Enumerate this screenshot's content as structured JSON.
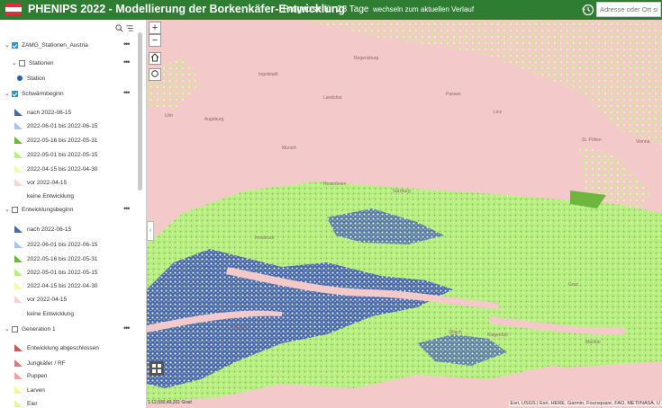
{
  "header": {
    "title": "PHENIPS 2022 - Modellierung der Borkenkäfer-Entwicklung",
    "forecast": "Prognose für 28 Tage",
    "switch_link": "wechseln zum aktuellen Verlauf",
    "search_placeholder": "Adresse oder Ort suchen",
    "flag_colors": [
      "#ed2939",
      "#ffffff",
      "#ed2939"
    ]
  },
  "layers": [
    {
      "kind": "layer",
      "label": "ZAMG_Stationen_Austria",
      "checked": true
    },
    {
      "kind": "sublayer",
      "label": "Stationen",
      "checked": false
    },
    {
      "kind": "legend",
      "label": "Station",
      "color": "#2a5db0",
      "shape": "dot"
    },
    {
      "kind": "layer",
      "label": "Schwärmbeginn",
      "checked": true
    },
    {
      "kind": "legend",
      "label": "nach 2022-06-15",
      "color": "#4a69a7"
    },
    {
      "kind": "legend",
      "label": "2022-06-01 bis 2022-06-15",
      "color": "#a9c6f0"
    },
    {
      "kind": "legend",
      "label": "2022-05-16 bis 2022-05-31",
      "color": "#6fb63f"
    },
    {
      "kind": "legend",
      "label": "2022-05-01 bis 2022-05-15",
      "color": "#b9f07a"
    },
    {
      "kind": "legend",
      "label": "2022-04-15 bis 2022-04-30",
      "color": "#f0fbb0"
    },
    {
      "kind": "legend",
      "label": "vor 2022-04-15",
      "color": "#f8d3d3"
    },
    {
      "kind": "legend",
      "label": "keine Entwicklung",
      "color": "#ffffff"
    },
    {
      "kind": "layer",
      "label": "Entwicklungsbeginn",
      "checked": false
    },
    {
      "kind": "legend",
      "label": "nach 2022-06-15",
      "color": "#4a69a7"
    },
    {
      "kind": "legend",
      "label": "2022-06-01 bis 2022-06-15",
      "color": "#a9c6f0"
    },
    {
      "kind": "legend",
      "label": "2022-05-16 bis 2022-05-31",
      "color": "#6fb63f"
    },
    {
      "kind": "legend",
      "label": "2022-05-01 bis 2022-05-15",
      "color": "#b9f07a"
    },
    {
      "kind": "legend",
      "label": "2022-04-15 bis 2022-04-30",
      "color": "#f0fbb0"
    },
    {
      "kind": "legend",
      "label": "vor 2022-04-15",
      "color": "#f8d3d3"
    },
    {
      "kind": "legend",
      "label": "keine Entwicklung",
      "color": "#ffffff"
    },
    {
      "kind": "layer",
      "label": "Generation 1",
      "checked": false
    },
    {
      "kind": "legend",
      "label": "Entwicklung abgeschlossen",
      "color": "#c55a5a"
    },
    {
      "kind": "legend",
      "label": "Jungkäfer / RF",
      "color": "#e07a7a"
    },
    {
      "kind": "legend",
      "label": "Puppen",
      "color": "#f3a0a0"
    },
    {
      "kind": "legend",
      "label": "Larven",
      "color": "#f5f59a"
    },
    {
      "kind": "legend",
      "label": "Eier",
      "color": "#e3f5a0"
    }
  ],
  "map": {
    "cities": [
      {
        "name": "Ulm"
      },
      {
        "name": "Augsburg"
      },
      {
        "name": "Munich"
      },
      {
        "name": "Ingolstadt"
      },
      {
        "name": "Regensburg"
      },
      {
        "name": "Landshut"
      },
      {
        "name": "Passau"
      },
      {
        "name": "Linz"
      },
      {
        "name": "St. Pölten"
      },
      {
        "name": "Vienna"
      },
      {
        "name": "Salzburg"
      },
      {
        "name": "Rosenheim"
      },
      {
        "name": "Innsbruck"
      },
      {
        "name": "Graz"
      },
      {
        "name": "Klagenfurt"
      },
      {
        "name": "Villach"
      },
      {
        "name": "Bolzano"
      },
      {
        "name": "Maribor"
      }
    ],
    "scale": "1:12,930,49,201 Grad",
    "attribution": "Esri, USGS | Esri, HERE, Garmin, Foursquare, FAO, METI/NASA, U"
  }
}
